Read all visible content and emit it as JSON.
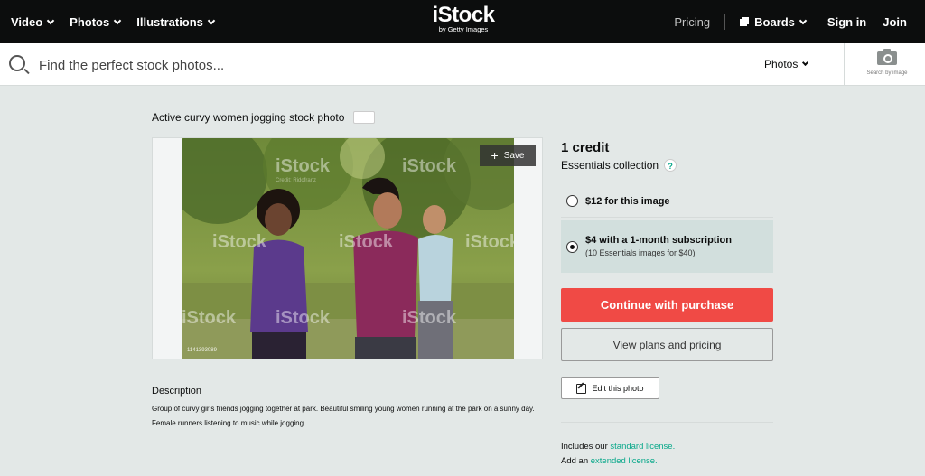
{
  "nav": {
    "video": "Video",
    "photos": "Photos",
    "illustrations": "Illustrations",
    "logo": "iStock",
    "logo_sub": "by Getty Images",
    "pricing": "Pricing",
    "boards": "Boards",
    "signin": "Sign in",
    "join": "Join"
  },
  "search": {
    "placeholder": "Find the perfect stock photos...",
    "type": "Photos",
    "by_image": "Search by image"
  },
  "photo": {
    "title": "Active curvy women jogging stock photo",
    "more": "···",
    "save": "Save",
    "plus": "+",
    "watermark": "iStock",
    "watermark_sub": "Credit: Ridofranz",
    "id": "1141393089"
  },
  "description": {
    "heading": "Description",
    "text": "Group of curvy girls friends jogging together at park. Beautiful smiling young women running at the park on a sunny day. Female runners listening to music while jogging."
  },
  "purchase": {
    "credits": "1 credit",
    "collection": "Essentials collection",
    "help": "?",
    "option1": "$12 for this image",
    "option2": "$4 with a 1-month subscription",
    "option2_sub": "(10 Essentials images for $40)",
    "continue": "Continue with purchase",
    "view_plans": "View plans and pricing",
    "edit": "Edit this photo",
    "license1_prefix": "Includes our ",
    "license1_link": "standard license.",
    "license2_prefix": "Add an ",
    "license2_link": "extended license."
  },
  "colors": {
    "accent_red": "#f04a45",
    "link_green": "#08a88a",
    "nav_black": "#0c0d0d",
    "page_bg": "#e3e8e7"
  }
}
